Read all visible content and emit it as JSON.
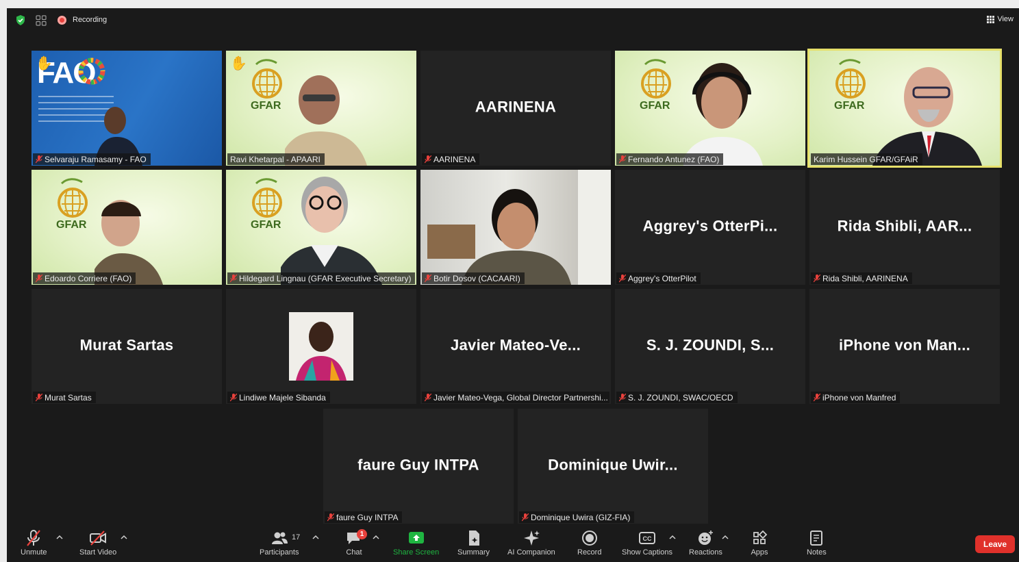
{
  "topbar": {
    "recording_label": "Recording",
    "view_label": "View",
    "security_icon": "shield-check-icon",
    "recording_icon": "record-dot-icon",
    "accent_green": "#2eb84a",
    "recording_red": "#e8413c"
  },
  "tiles": [
    {
      "name": "Selvaraju Ramasamy - FAO",
      "display": "",
      "bg": "fao",
      "speaking": false,
      "hand_raised": true
    },
    {
      "name": "Ravi Khetarpal - APAARI",
      "display": "",
      "bg": "gfar",
      "speaking": false,
      "hand_raised": true
    },
    {
      "name": "AARINENA",
      "display": "AARINENA",
      "bg": "none",
      "speaking": false,
      "hand_raised": false
    },
    {
      "name": "Fernando Antunez (FAO)",
      "display": "",
      "bg": "gfar",
      "speaking": false,
      "hand_raised": false
    },
    {
      "name": "Karim Hussein GFAR/GFAiR",
      "display": "",
      "bg": "gfar",
      "speaking": true,
      "hand_raised": false
    },
    {
      "name": "Edoardo Corriere (FAO)",
      "display": "",
      "bg": "gfar",
      "speaking": false,
      "hand_raised": false
    },
    {
      "name": "Hildegard Lingnau (GFAR Executive Secretary)",
      "display": "",
      "bg": "gfar",
      "speaking": false,
      "hand_raised": false
    },
    {
      "name": "Botir Dosov (CACAARI)",
      "display": "",
      "bg": "room",
      "speaking": false,
      "hand_raised": false
    },
    {
      "name": "Aggrey's OtterPilot",
      "display": "Aggrey's  OtterPi...",
      "bg": "none",
      "speaking": false,
      "hand_raised": false
    },
    {
      "name": "Rida Shibli, AARINENA",
      "display": "Rida Shibli, AAR...",
      "bg": "none",
      "speaking": false,
      "hand_raised": false
    },
    {
      "name": "Murat Sartas",
      "display": "Murat Sartas",
      "bg": "none",
      "speaking": false,
      "hand_raised": false
    },
    {
      "name": "Lindiwe Majele Sibanda",
      "display": "",
      "bg": "photo",
      "speaking": false,
      "hand_raised": false
    },
    {
      "name": "Javier Mateo-Vega, Global Director Partnershi...",
      "display": "Javier  Mateo-Ve...",
      "bg": "none",
      "speaking": false,
      "hand_raised": false
    },
    {
      "name": "S. J. ZOUNDI, SWAC/OECD",
      "display": "S. J. ZOUNDI, S...",
      "bg": "none",
      "speaking": false,
      "hand_raised": false
    },
    {
      "name": "iPhone von Manfred",
      "display": "iPhone von Man...",
      "bg": "none",
      "speaking": false,
      "hand_raised": false
    },
    {
      "name": "faure Guy INTPA",
      "display": "faure Guy INTPA",
      "bg": "none",
      "speaking": false,
      "hand_raised": false
    },
    {
      "name": "Dominique Uwira (GIZ-FIA)",
      "display": "Dominique  Uwir...",
      "bg": "none",
      "speaking": false,
      "hand_raised": false
    }
  ],
  "gfar_logo_text": "GFAR",
  "fao_logo_text": "FAO",
  "toolbar": {
    "unmute": "Unmute",
    "start_video": "Start Video",
    "participants": "Participants",
    "participants_count": "17",
    "chat": "Chat",
    "chat_badge": "1",
    "share_screen": "Share Screen",
    "summary": "Summary",
    "ai_companion": "AI Companion",
    "record": "Record",
    "show_captions": "Show Captions",
    "reactions": "Reactions",
    "apps": "Apps",
    "notes": "Notes",
    "leave": "Leave",
    "share_color": "#1fb541",
    "leave_color": "#e0312b"
  }
}
